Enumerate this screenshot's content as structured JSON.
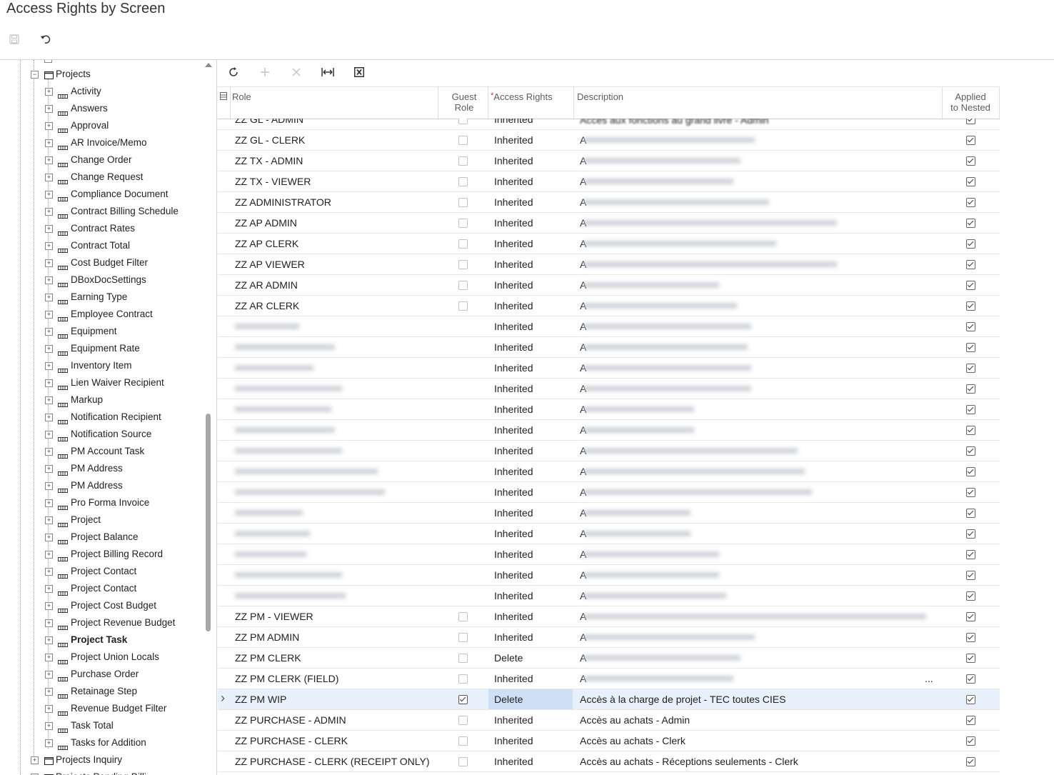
{
  "title": "Access Rights by Screen",
  "toolbar": {
    "save_icon": "save-icon",
    "undo_icon": "undo-icon"
  },
  "tree": {
    "partial_top": "",
    "projects_label": "Projects",
    "items": [
      "Activity",
      "Answers",
      "Approval",
      "AR Invoice/Memo",
      "Change Order",
      "Change Request",
      "Compliance Document",
      "Contract Billing Schedule",
      "Contract Rates",
      "Contract Total",
      "Cost Budget Filter",
      "DBoxDocSettings",
      "Earning Type",
      "Employee Contract",
      "Equipment",
      "Equipment Rate",
      "Inventory Item",
      "Lien Waiver Recipient",
      "Markup",
      "Notification Recipient",
      "Notification Source",
      "PM Account Task",
      "PM Address",
      "PM Address",
      "Pro Forma Invoice",
      "Project",
      "Project Balance",
      "Project Billing Record",
      "Project Contact",
      "Project Contact",
      "Project Cost Budget",
      "Project Revenue Budget",
      "Project Task",
      "Project Union Locals",
      "Purchase Order",
      "Retainage Step",
      "Revenue Budget Filter",
      "Task Total",
      "Tasks for Addition"
    ],
    "selected_item": "Project Task",
    "projects_inquiry_label": "Projects Inquiry",
    "partial_bottom": "Projects Pending Billi..."
  },
  "grid": {
    "columns": {
      "role": "Role",
      "guest": "Guest Role",
      "guest_line1": "Guest",
      "guest_line2": "Role",
      "required_mark": "*",
      "access": "Access Rights",
      "description": "Description",
      "applied_line1": "Applied",
      "applied_line2": "to Nested"
    },
    "rows": [
      {
        "role": "ZZ GL - ADMIN",
        "guest": false,
        "access": "Inherited",
        "desc": "Accès aux fonctions au grand livre - Admin",
        "applied": true,
        "blur_role": false,
        "blur_desc": true,
        "partial": true
      },
      {
        "role": "ZZ GL - CLERK",
        "guest": false,
        "access": "Inherited",
        "desc": "A",
        "applied": true,
        "blur_role": false,
        "blur_desc": true
      },
      {
        "role": "ZZ TX - ADMIN",
        "guest": false,
        "access": "Inherited",
        "desc": "A",
        "applied": true,
        "blur_role": false,
        "blur_desc": true
      },
      {
        "role": "ZZ TX - VIEWER",
        "guest": false,
        "access": "Inherited",
        "desc": "A",
        "applied": true,
        "blur_role": false,
        "blur_desc": true
      },
      {
        "role": "ZZ ADMINISTRATOR",
        "guest": false,
        "access": "Inherited",
        "desc": "A",
        "applied": true,
        "blur_role": false,
        "blur_desc": true
      },
      {
        "role": "ZZ AP ADMIN",
        "guest": false,
        "access": "Inherited",
        "desc": "A",
        "applied": true,
        "blur_role": false,
        "blur_desc": true
      },
      {
        "role": "ZZ AP CLERK",
        "guest": false,
        "access": "Inherited",
        "desc": "A",
        "applied": true,
        "blur_role": false,
        "blur_desc": true
      },
      {
        "role": "ZZ AP VIEWER",
        "guest": false,
        "access": "Inherited",
        "desc": "A",
        "applied": true,
        "blur_role": false,
        "blur_desc": true
      },
      {
        "role": "ZZ AR ADMIN",
        "guest": false,
        "access": "Inherited",
        "desc": "A",
        "applied": true,
        "blur_role": false,
        "blur_desc": true
      },
      {
        "role": "ZZ AR CLERK",
        "guest": false,
        "access": "Inherited",
        "desc": "A",
        "applied": true,
        "blur_role": false,
        "blur_desc": true
      },
      {
        "role": "",
        "guest": false,
        "access": "Inherited",
        "desc": "A",
        "applied": true,
        "blur_role": true,
        "blur_desc": true
      },
      {
        "role": "",
        "guest": false,
        "access": "Inherited",
        "desc": "A",
        "applied": true,
        "blur_role": true,
        "blur_desc": true
      },
      {
        "role": "",
        "guest": false,
        "access": "Inherited",
        "desc": "A",
        "applied": true,
        "blur_role": true,
        "blur_desc": true
      },
      {
        "role": "",
        "guest": false,
        "access": "Inherited",
        "desc": "A",
        "applied": true,
        "blur_role": true,
        "blur_desc": true
      },
      {
        "role": "",
        "guest": false,
        "access": "Inherited",
        "desc": "A",
        "applied": true,
        "blur_role": true,
        "blur_desc": true
      },
      {
        "role": "",
        "guest": false,
        "access": "Inherited",
        "desc": "A",
        "applied": true,
        "blur_role": true,
        "blur_desc": true
      },
      {
        "role": "",
        "guest": false,
        "access": "Inherited",
        "desc": "A",
        "applied": true,
        "blur_role": true,
        "blur_desc": true
      },
      {
        "role": "",
        "guest": false,
        "access": "Inherited",
        "desc": "A",
        "applied": true,
        "blur_role": true,
        "blur_desc": true
      },
      {
        "role": "",
        "guest": false,
        "access": "Inherited",
        "desc": "A",
        "applied": true,
        "blur_role": true,
        "blur_desc": true
      },
      {
        "role": "",
        "guest": false,
        "access": "Inherited",
        "desc": "A",
        "applied": true,
        "blur_role": true,
        "blur_desc": true
      },
      {
        "role": "",
        "guest": false,
        "access": "Inherited",
        "desc": "A",
        "applied": true,
        "blur_role": true,
        "blur_desc": true
      },
      {
        "role": "",
        "guest": false,
        "access": "Inherited",
        "desc": "A",
        "applied": true,
        "blur_role": true,
        "blur_desc": true
      },
      {
        "role": "",
        "guest": false,
        "access": "Inherited",
        "desc": "A",
        "applied": true,
        "blur_role": true,
        "blur_desc": true
      },
      {
        "role": "",
        "guest": false,
        "access": "Inherited",
        "desc": "A",
        "applied": true,
        "blur_role": true,
        "blur_desc": true
      },
      {
        "role": "ZZ PM - VIEWER",
        "guest": false,
        "access": "Inherited",
        "desc": "A",
        "applied": true,
        "blur_role": false,
        "blur_desc": true
      },
      {
        "role": "ZZ PM ADMIN",
        "guest": false,
        "access": "Inherited",
        "desc": "A",
        "applied": true,
        "blur_role": false,
        "blur_desc": true
      },
      {
        "role": "ZZ PM CLERK",
        "guest": false,
        "access": "Delete",
        "desc": "A",
        "applied": true,
        "blur_role": false,
        "blur_desc": true
      },
      {
        "role": "ZZ PM CLERK (FIELD)",
        "guest": false,
        "access": "Inherited",
        "desc": "A",
        "applied": true,
        "blur_role": false,
        "blur_desc": true,
        "ellipsis": "..."
      },
      {
        "role": "ZZ PM WIP",
        "guest": true,
        "access": "Delete",
        "desc": "Accès à la charge de projet - TEC toutes CIES",
        "applied": true,
        "blur_role": false,
        "blur_desc": false,
        "selected": true
      },
      {
        "role": "ZZ PURCHASE - ADMIN",
        "guest": false,
        "access": "Inherited",
        "desc": "Accès au achats - Admin",
        "applied": true,
        "blur_role": false,
        "blur_desc": false
      },
      {
        "role": "ZZ PURCHASE - CLERK",
        "guest": false,
        "access": "Inherited",
        "desc": "Accès au achats - Clerk",
        "applied": true,
        "blur_role": false,
        "blur_desc": false
      },
      {
        "role": "ZZ PURCHASE - CLERK (RECEIPT ONLY)",
        "guest": false,
        "access": "Inherited",
        "desc": "Accès au achats - Réceptions seulements - Clerk",
        "applied": true,
        "blur_role": false,
        "blur_desc": false
      }
    ]
  },
  "grid_toolbar": {
    "refresh_icon": "refresh-icon",
    "add_icon": "add-icon",
    "delete_icon": "delete-icon",
    "fit_icon": "fit-columns-icon",
    "excel_icon": "excel-export-icon"
  },
  "colors": {
    "selected_row": "#e8f0fb",
    "selected_cell": "#cfe0f6",
    "required": "#d32f2f"
  }
}
